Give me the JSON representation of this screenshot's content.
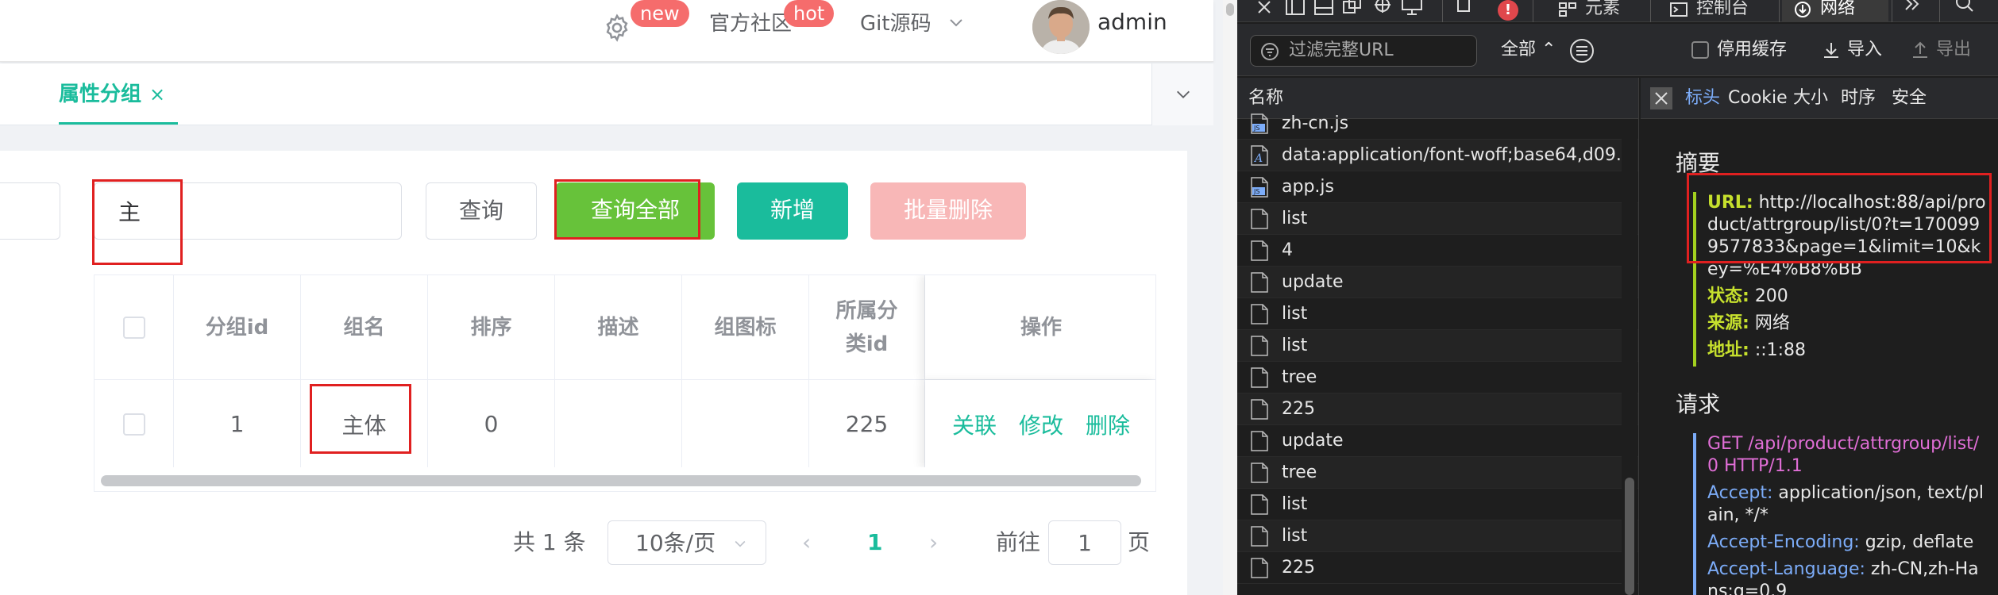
{
  "header": {
    "badge_new": "new",
    "badge_hot": "hot",
    "community": "官方社区",
    "git_source": "Git源码",
    "username": "admin"
  },
  "tabs": {
    "active_label": "属性分组",
    "close_glyph": "×"
  },
  "search": {
    "keyword_value": "主",
    "query_label": "查询",
    "query_all_label": "查询全部",
    "add_label": "新增",
    "batch_delete_label": "批量删除"
  },
  "table": {
    "headers": {
      "group_id": "分组id",
      "group_name": "组名",
      "sort": "排序",
      "description": "描述",
      "group_icon": "组图标",
      "category_id": "所属分类id",
      "actions": "操作"
    },
    "row": {
      "group_id": "1",
      "group_name": "主体",
      "sort": "0",
      "description": "",
      "group_icon": "",
      "category_id": "225"
    },
    "actions": {
      "relate": "关联",
      "edit": "修改",
      "delete": "删除"
    }
  },
  "pager": {
    "total": "共 1 条",
    "page_size": "10条/页",
    "prev": "‹",
    "current": "1",
    "next": "›",
    "goto_label": "前往",
    "goto_value": "1",
    "page_suffix": "页"
  },
  "devtools": {
    "tabs": {
      "elements": "元素",
      "console": "控制台",
      "network": "网络"
    },
    "error_count": "!",
    "filter_placeholder": "过滤完整URL",
    "filter_all": "全部",
    "disable_cache": "停用缓存",
    "import": "导入",
    "export": "导出",
    "list_header": "名称",
    "requests": [
      {
        "name": "zh-cn.js",
        "type": "js"
      },
      {
        "name": "data:application/font-woff;base64,d09...",
        "type": "font"
      },
      {
        "name": "app.js",
        "type": "js"
      },
      {
        "name": "list",
        "type": "doc"
      },
      {
        "name": "4",
        "type": "doc"
      },
      {
        "name": "update",
        "type": "doc"
      },
      {
        "name": "list",
        "type": "doc"
      },
      {
        "name": "list",
        "type": "doc"
      },
      {
        "name": "tree",
        "type": "doc"
      },
      {
        "name": "225",
        "type": "doc"
      },
      {
        "name": "update",
        "type": "doc"
      },
      {
        "name": "tree",
        "type": "doc"
      },
      {
        "name": "list",
        "type": "doc"
      },
      {
        "name": "list",
        "type": "doc"
      },
      {
        "name": "225",
        "type": "doc"
      }
    ],
    "detail_tabs": {
      "headers": "标头",
      "cookie": "Cookie",
      "size": "大小",
      "timing": "时序",
      "security": "安全"
    },
    "summary_title": "摘要",
    "summary": {
      "url_key": "URL:",
      "url_value": "http://localhost:88/api/product/attrgroup/list/0?t=1700999577833&page=1&limit=10&key=%E4%B8%BB",
      "status_key": "状态:",
      "status_value": "200",
      "source_key": "来源:",
      "source_value": "网络",
      "address_key": "地址:",
      "address_value": "::1:88"
    },
    "request_title": "请求",
    "request": {
      "request_line": "GET /api/product/attrgroup/list/0 HTTP/1.1",
      "accept_key": "Accept:",
      "accept_value": "application/json, text/plain, */*",
      "encoding_key": "Accept-Encoding:",
      "encoding_value": "gzip, deflate",
      "language_key": "Accept-Language:",
      "language_value": "zh-CN,zh-Hans;q=0.9"
    }
  },
  "colors": {
    "accent": "#1abc9c",
    "success": "#67c23a",
    "danger_light": "#f8b7b7",
    "badge": "#f56c6c",
    "highlight_box": "#e02020"
  }
}
